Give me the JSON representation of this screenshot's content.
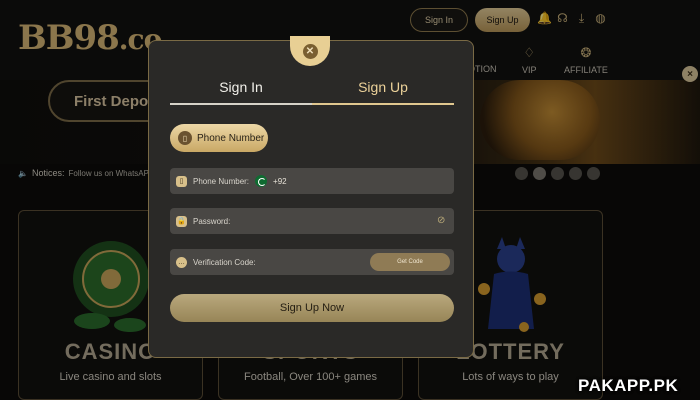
{
  "site": {
    "logo": "BB98",
    "logo_suffix": ".co",
    "header_signin": "Sign In",
    "header_signup": "Sign Up",
    "nav": [
      {
        "label": "OTION",
        "icon": "promotion-icon"
      },
      {
        "label": "VIP",
        "icon": "diamond-icon"
      },
      {
        "label": "AFFILIATE",
        "icon": "affiliate-icon"
      }
    ],
    "banner_text": "First Depos",
    "notice_label": "Notices:",
    "notice_text": "Follow us on WhatsAPP Ch",
    "cards": [
      {
        "title": "CASINO",
        "subtitle": "Live casino and slots"
      },
      {
        "title": "SPORTS",
        "subtitle": "Football, Over 100+ games"
      },
      {
        "title": "LOTTERY",
        "subtitle": "Lots of ways to play"
      }
    ],
    "watermark": "PAKAPP.PK"
  },
  "modal": {
    "tabs": [
      {
        "label": "Sign In",
        "active": false
      },
      {
        "label": "Sign Up",
        "active": true
      }
    ],
    "method_label": "Phone Number",
    "phone_label": "Phone Number:",
    "country_code": "+92",
    "password_label": "Password:",
    "verification_label": "Verification Code:",
    "get_code_label": "Get Code",
    "submit_label": "Sign Up Now"
  },
  "colors": {
    "accent_gold": "#e0c78f",
    "modal_bg": "#2a2927",
    "field_bg": "#494744"
  }
}
